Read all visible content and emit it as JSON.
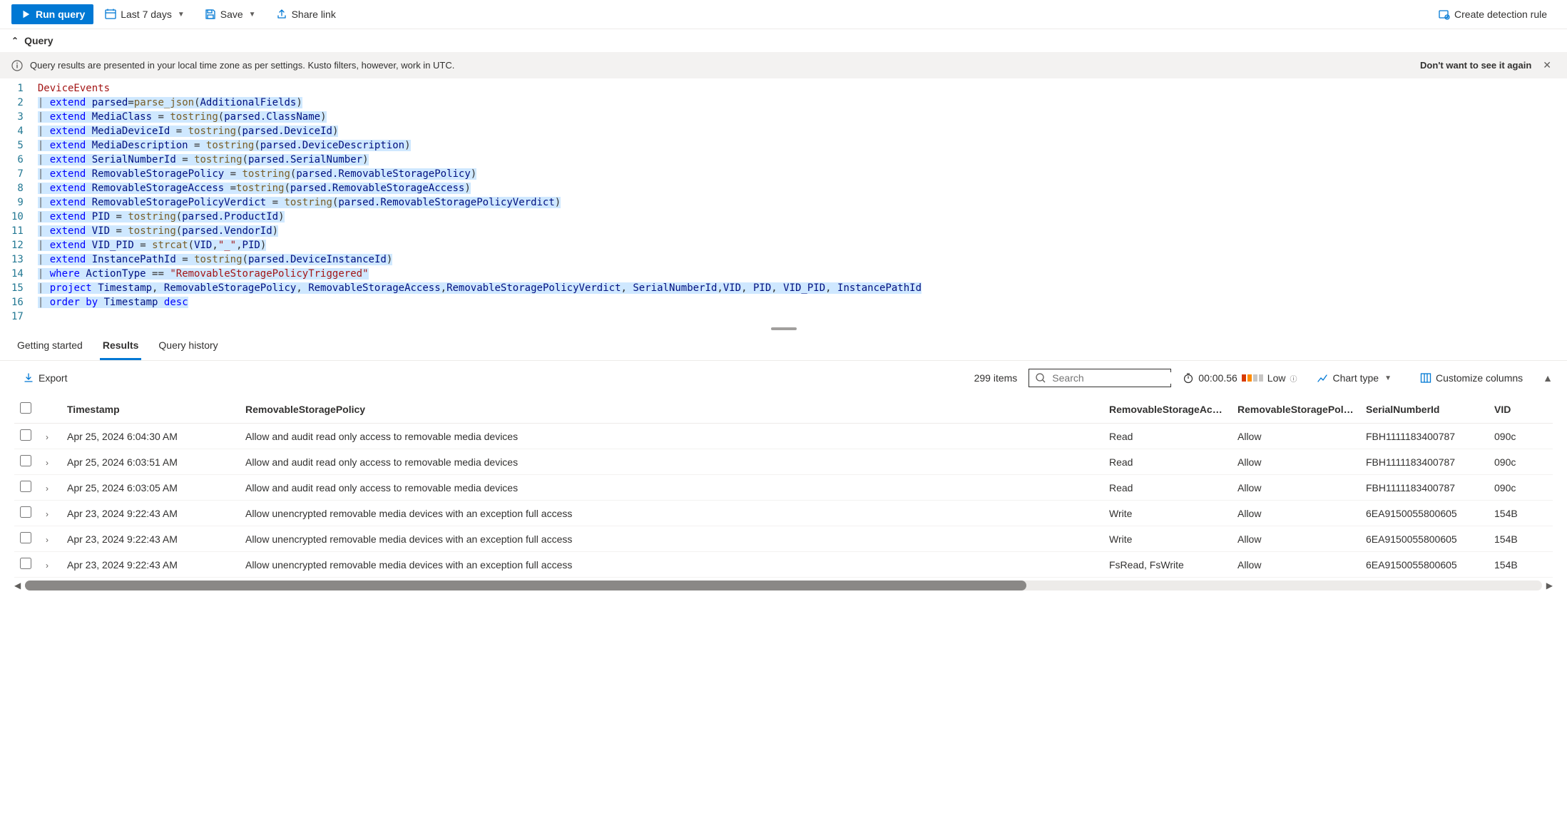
{
  "toolbar": {
    "run": "Run query",
    "time_range": "Last 7 days",
    "save": "Save",
    "share": "Share link",
    "create_rule": "Create detection rule"
  },
  "section": {
    "title": "Query"
  },
  "banner": {
    "message": "Query results are presented in your local time zone as per settings. Kusto filters, however, work in UTC.",
    "dismiss": "Don't want to see it again"
  },
  "editor": {
    "lines": [
      {
        "n": 1,
        "seg": [
          {
            "t": "DeviceEvents",
            "c": "tok-table"
          }
        ]
      },
      {
        "n": 2,
        "sel": true,
        "seg": [
          {
            "t": "|",
            "c": "tok-pipe"
          },
          {
            "t": " ",
            "c": ""
          },
          {
            "t": "extend",
            "c": "tok-kw"
          },
          {
            "t": " ",
            "c": ""
          },
          {
            "t": "parsed",
            "c": "tok-ident"
          },
          {
            "t": "=",
            "c": "tok-punc"
          },
          {
            "t": "parse_json",
            "c": "tok-func"
          },
          {
            "t": "(",
            "c": "tok-punc"
          },
          {
            "t": "AdditionalFields",
            "c": "tok-ident"
          },
          {
            "t": ")",
            "c": "tok-punc"
          }
        ]
      },
      {
        "n": 3,
        "sel": true,
        "seg": [
          {
            "t": "|",
            "c": "tok-pipe"
          },
          {
            "t": " ",
            "c": ""
          },
          {
            "t": "extend",
            "c": "tok-kw"
          },
          {
            "t": " ",
            "c": ""
          },
          {
            "t": "MediaClass",
            "c": "tok-ident"
          },
          {
            "t": " = ",
            "c": "tok-punc"
          },
          {
            "t": "tostring",
            "c": "tok-func"
          },
          {
            "t": "(",
            "c": "tok-punc"
          },
          {
            "t": "parsed.ClassName",
            "c": "tok-ident"
          },
          {
            "t": ")",
            "c": "tok-punc"
          }
        ]
      },
      {
        "n": 4,
        "sel": true,
        "seg": [
          {
            "t": "|",
            "c": "tok-pipe"
          },
          {
            "t": " ",
            "c": ""
          },
          {
            "t": "extend",
            "c": "tok-kw"
          },
          {
            "t": " ",
            "c": ""
          },
          {
            "t": "MediaDeviceId",
            "c": "tok-ident"
          },
          {
            "t": " = ",
            "c": "tok-punc"
          },
          {
            "t": "tostring",
            "c": "tok-func"
          },
          {
            "t": "(",
            "c": "tok-punc"
          },
          {
            "t": "parsed.DeviceId",
            "c": "tok-ident"
          },
          {
            "t": ")",
            "c": "tok-punc"
          }
        ]
      },
      {
        "n": 5,
        "sel": true,
        "seg": [
          {
            "t": "|",
            "c": "tok-pipe"
          },
          {
            "t": " ",
            "c": ""
          },
          {
            "t": "extend",
            "c": "tok-kw"
          },
          {
            "t": " ",
            "c": ""
          },
          {
            "t": "MediaDescription",
            "c": "tok-ident"
          },
          {
            "t": " = ",
            "c": "tok-punc"
          },
          {
            "t": "tostring",
            "c": "tok-func"
          },
          {
            "t": "(",
            "c": "tok-punc"
          },
          {
            "t": "parsed.DeviceDescription",
            "c": "tok-ident"
          },
          {
            "t": ")",
            "c": "tok-punc"
          }
        ]
      },
      {
        "n": 6,
        "sel": true,
        "seg": [
          {
            "t": "|",
            "c": "tok-pipe"
          },
          {
            "t": " ",
            "c": ""
          },
          {
            "t": "extend",
            "c": "tok-kw"
          },
          {
            "t": " ",
            "c": ""
          },
          {
            "t": "SerialNumberId",
            "c": "tok-ident"
          },
          {
            "t": " = ",
            "c": "tok-punc"
          },
          {
            "t": "tostring",
            "c": "tok-func"
          },
          {
            "t": "(",
            "c": "tok-punc"
          },
          {
            "t": "parsed.SerialNumber",
            "c": "tok-ident"
          },
          {
            "t": ")",
            "c": "tok-punc"
          }
        ]
      },
      {
        "n": 7,
        "sel": true,
        "seg": [
          {
            "t": "|",
            "c": "tok-pipe"
          },
          {
            "t": " ",
            "c": ""
          },
          {
            "t": "extend",
            "c": "tok-kw"
          },
          {
            "t": " ",
            "c": ""
          },
          {
            "t": "RemovableStoragePolicy",
            "c": "tok-ident"
          },
          {
            "t": " = ",
            "c": "tok-punc"
          },
          {
            "t": "tostring",
            "c": "tok-func"
          },
          {
            "t": "(",
            "c": "tok-punc"
          },
          {
            "t": "parsed.RemovableStoragePolicy",
            "c": "tok-ident"
          },
          {
            "t": ")",
            "c": "tok-punc"
          }
        ]
      },
      {
        "n": 8,
        "sel": true,
        "seg": [
          {
            "t": "|",
            "c": "tok-pipe"
          },
          {
            "t": " ",
            "c": ""
          },
          {
            "t": "extend",
            "c": "tok-kw"
          },
          {
            "t": " ",
            "c": ""
          },
          {
            "t": "RemovableStorageAccess",
            "c": "tok-ident"
          },
          {
            "t": " =",
            "c": "tok-punc"
          },
          {
            "t": "tostring",
            "c": "tok-func"
          },
          {
            "t": "(",
            "c": "tok-punc"
          },
          {
            "t": "parsed.RemovableStorageAccess",
            "c": "tok-ident"
          },
          {
            "t": ")",
            "c": "tok-punc"
          }
        ]
      },
      {
        "n": 9,
        "sel": true,
        "seg": [
          {
            "t": "|",
            "c": "tok-pipe"
          },
          {
            "t": " ",
            "c": ""
          },
          {
            "t": "extend",
            "c": "tok-kw"
          },
          {
            "t": " ",
            "c": ""
          },
          {
            "t": "RemovableStoragePolicyVerdict",
            "c": "tok-ident"
          },
          {
            "t": " = ",
            "c": "tok-punc"
          },
          {
            "t": "tostring",
            "c": "tok-func"
          },
          {
            "t": "(",
            "c": "tok-punc"
          },
          {
            "t": "parsed.RemovableStoragePolicyVerdict",
            "c": "tok-ident"
          },
          {
            "t": ")",
            "c": "tok-punc"
          }
        ]
      },
      {
        "n": 10,
        "sel": true,
        "seg": [
          {
            "t": "|",
            "c": "tok-pipe"
          },
          {
            "t": " ",
            "c": ""
          },
          {
            "t": "extend",
            "c": "tok-kw"
          },
          {
            "t": " ",
            "c": ""
          },
          {
            "t": "PID",
            "c": "tok-ident"
          },
          {
            "t": " = ",
            "c": "tok-punc"
          },
          {
            "t": "tostring",
            "c": "tok-func"
          },
          {
            "t": "(",
            "c": "tok-punc"
          },
          {
            "t": "parsed.ProductId",
            "c": "tok-ident"
          },
          {
            "t": ")",
            "c": "tok-punc"
          }
        ]
      },
      {
        "n": 11,
        "sel": true,
        "seg": [
          {
            "t": "|",
            "c": "tok-pipe"
          },
          {
            "t": " ",
            "c": ""
          },
          {
            "t": "extend",
            "c": "tok-kw"
          },
          {
            "t": " ",
            "c": ""
          },
          {
            "t": "VID",
            "c": "tok-ident"
          },
          {
            "t": " = ",
            "c": "tok-punc"
          },
          {
            "t": "tostring",
            "c": "tok-func"
          },
          {
            "t": "(",
            "c": "tok-punc"
          },
          {
            "t": "parsed.VendorId",
            "c": "tok-ident"
          },
          {
            "t": ")",
            "c": "tok-punc"
          }
        ]
      },
      {
        "n": 12,
        "sel": true,
        "seg": [
          {
            "t": "|",
            "c": "tok-pipe"
          },
          {
            "t": " ",
            "c": ""
          },
          {
            "t": "extend",
            "c": "tok-kw"
          },
          {
            "t": " ",
            "c": ""
          },
          {
            "t": "VID_PID",
            "c": "tok-ident"
          },
          {
            "t": " = ",
            "c": "tok-punc"
          },
          {
            "t": "strcat",
            "c": "tok-func"
          },
          {
            "t": "(",
            "c": "tok-punc"
          },
          {
            "t": "VID",
            "c": "tok-ident"
          },
          {
            "t": ",",
            "c": "tok-punc"
          },
          {
            "t": "\"_\"",
            "c": "tok-str"
          },
          {
            "t": ",",
            "c": "tok-punc"
          },
          {
            "t": "PID",
            "c": "tok-ident"
          },
          {
            "t": ")",
            "c": "tok-punc"
          }
        ]
      },
      {
        "n": 13,
        "sel": true,
        "seg": [
          {
            "t": "|",
            "c": "tok-pipe"
          },
          {
            "t": " ",
            "c": ""
          },
          {
            "t": "extend",
            "c": "tok-kw"
          },
          {
            "t": " ",
            "c": ""
          },
          {
            "t": "InstancePathId",
            "c": "tok-ident"
          },
          {
            "t": " = ",
            "c": "tok-punc"
          },
          {
            "t": "tostring",
            "c": "tok-func"
          },
          {
            "t": "(",
            "c": "tok-punc"
          },
          {
            "t": "parsed.DeviceInstanceId",
            "c": "tok-ident"
          },
          {
            "t": ")",
            "c": "tok-punc"
          }
        ]
      },
      {
        "n": 14,
        "sel": true,
        "seg": [
          {
            "t": "|",
            "c": "tok-pipe"
          },
          {
            "t": " ",
            "c": ""
          },
          {
            "t": "where",
            "c": "tok-kw"
          },
          {
            "t": " ",
            "c": ""
          },
          {
            "t": "ActionType",
            "c": "tok-ident"
          },
          {
            "t": " == ",
            "c": "tok-punc"
          },
          {
            "t": "\"RemovableStoragePolicyTriggered\"",
            "c": "tok-str"
          }
        ]
      },
      {
        "n": 15,
        "sel": true,
        "seg": [
          {
            "t": "|",
            "c": "tok-pipe"
          },
          {
            "t": " ",
            "c": ""
          },
          {
            "t": "project",
            "c": "tok-kw"
          },
          {
            "t": " ",
            "c": ""
          },
          {
            "t": "Timestamp",
            "c": "tok-ident"
          },
          {
            "t": ", ",
            "c": "tok-punc"
          },
          {
            "t": "RemovableStoragePolicy",
            "c": "tok-ident"
          },
          {
            "t": ", ",
            "c": "tok-punc"
          },
          {
            "t": "RemovableStorageAccess",
            "c": "tok-ident"
          },
          {
            "t": ",",
            "c": "tok-punc"
          },
          {
            "t": "RemovableStoragePolicyVerdict",
            "c": "tok-ident"
          },
          {
            "t": ", ",
            "c": "tok-punc"
          },
          {
            "t": "SerialNumberId",
            "c": "tok-ident"
          },
          {
            "t": ",",
            "c": "tok-punc"
          },
          {
            "t": "VID",
            "c": "tok-ident"
          },
          {
            "t": ", ",
            "c": "tok-punc"
          },
          {
            "t": "PID",
            "c": "tok-ident"
          },
          {
            "t": ", ",
            "c": "tok-punc"
          },
          {
            "t": "VID_PID",
            "c": "tok-ident"
          },
          {
            "t": ", ",
            "c": "tok-punc"
          },
          {
            "t": "InstancePathId",
            "c": "tok-ident"
          }
        ]
      },
      {
        "n": 16,
        "sel": true,
        "seg": [
          {
            "t": "|",
            "c": "tok-pipe"
          },
          {
            "t": " ",
            "c": ""
          },
          {
            "t": "order by",
            "c": "tok-kw"
          },
          {
            "t": " ",
            "c": ""
          },
          {
            "t": "Timestamp",
            "c": "tok-ident"
          },
          {
            "t": " ",
            "c": ""
          },
          {
            "t": "desc",
            "c": "tok-kw"
          }
        ]
      },
      {
        "n": 17,
        "seg": []
      }
    ]
  },
  "tabs": {
    "getting_started": "Getting started",
    "results": "Results",
    "history": "Query history"
  },
  "results": {
    "export": "Export",
    "count": "299 items",
    "search_placeholder": "Search",
    "duration": "00:00.56",
    "perf_label": "Low",
    "chart_type": "Chart type",
    "customize": "Customize columns",
    "columns": {
      "timestamp": "Timestamp",
      "policy": "RemovableStoragePolicy",
      "access": "RemovableStorageAccess",
      "verdict": "RemovableStoragePolicyVer...",
      "serial": "SerialNumberId",
      "vid": "VID"
    },
    "rows": [
      {
        "ts": "Apr 25, 2024 6:04:30 AM",
        "policy": "Allow and audit read only access to removable media devices",
        "access": "Read",
        "verdict": "Allow",
        "serial": "FBH1111183400787",
        "vid": "090c"
      },
      {
        "ts": "Apr 25, 2024 6:03:51 AM",
        "policy": "Allow and audit read only access to removable media devices",
        "access": "Read",
        "verdict": "Allow",
        "serial": "FBH1111183400787",
        "vid": "090c"
      },
      {
        "ts": "Apr 25, 2024 6:03:05 AM",
        "policy": "Allow and audit read only access to removable media devices",
        "access": "Read",
        "verdict": "Allow",
        "serial": "FBH1111183400787",
        "vid": "090c"
      },
      {
        "ts": "Apr 23, 2024 9:22:43 AM",
        "policy": "Allow unencrypted removable media devices with an exception full access",
        "access": "Write",
        "verdict": "Allow",
        "serial": "6EA9150055800605",
        "vid": "154B"
      },
      {
        "ts": "Apr 23, 2024 9:22:43 AM",
        "policy": "Allow unencrypted removable media devices with an exception full access",
        "access": "Write",
        "verdict": "Allow",
        "serial": "6EA9150055800605",
        "vid": "154B"
      },
      {
        "ts": "Apr 23, 2024 9:22:43 AM",
        "policy": "Allow unencrypted removable media devices with an exception full access",
        "access": "FsRead, FsWrite",
        "verdict": "Allow",
        "serial": "6EA9150055800605",
        "vid": "154B"
      }
    ]
  }
}
